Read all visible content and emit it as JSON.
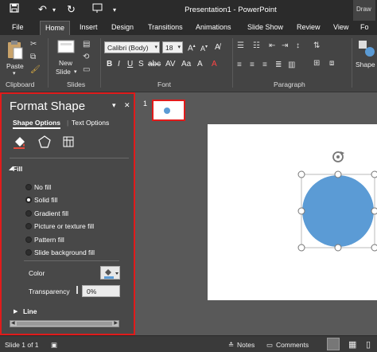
{
  "titlebar": {
    "title": "Presentation1 - PowerPoint",
    "draw_tab": "Draw"
  },
  "tabs": [
    "File",
    "Home",
    "Insert",
    "Design",
    "Transitions",
    "Animations",
    "Slide Show",
    "Review",
    "View",
    "Fo"
  ],
  "active_tab": "Home",
  "ribbon": {
    "clipboard": {
      "paste_label": "Paste",
      "group_label": "Clipboard"
    },
    "slides": {
      "new_slide_label": "New",
      "new_slide_label2": "Slide",
      "group_label": "Slides"
    },
    "font": {
      "font_name": "Calibri (Body)",
      "font_size": "18",
      "group_label": "Font"
    },
    "paragraph": {
      "group_label": "Paragraph"
    },
    "shapes_label": "Shape"
  },
  "format_pane": {
    "title": "Format Shape",
    "tabs": {
      "shape_options": "Shape Options",
      "text_options": "Text Options"
    },
    "fill_section": "Fill",
    "fill_options": [
      {
        "label": "No fill",
        "selected": false
      },
      {
        "label": "Solid fill",
        "selected": true
      },
      {
        "label": "Gradient fill",
        "selected": false
      },
      {
        "label": "Picture or texture fill",
        "selected": false
      },
      {
        "label": "Pattern fill",
        "selected": false
      },
      {
        "label": "Slide background fill",
        "selected": false
      }
    ],
    "color_label": "Color",
    "transparency_label": "Transparency",
    "transparency_value": "0%",
    "line_section": "Line"
  },
  "slide_panel": {
    "slide_number": "1"
  },
  "shape": {
    "fill_color": "#5b9bd5"
  },
  "statusbar": {
    "slide_info": "Slide 1 of 1",
    "notes_label": "Notes",
    "comments_label": "Comments"
  },
  "colors": {
    "accent_red": "#e01b1b",
    "title_bg": "#2b2b2b",
    "ribbon_bg": "#444444"
  }
}
